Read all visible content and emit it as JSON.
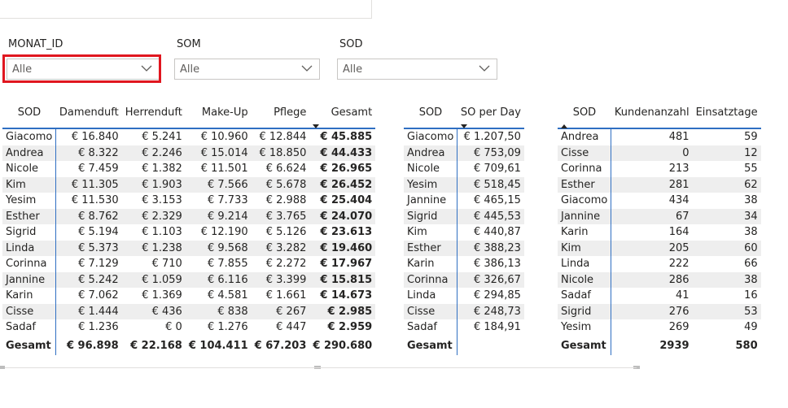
{
  "slicers": [
    {
      "label": "MONAT_ID",
      "value": "Alle"
    },
    {
      "label": "SOM",
      "value": "Alle"
    },
    {
      "label": "SOD",
      "value": "Alle"
    }
  ],
  "table1": {
    "headers": [
      "SOD",
      "Damenduft",
      "Herrenduft",
      "Make-Up",
      "Pflege",
      "Gesamt"
    ],
    "rows": [
      [
        "Giacomo",
        "€ 16.840",
        "€ 5.241",
        "€ 10.960",
        "€ 12.844",
        "€ 45.885"
      ],
      [
        "Andrea",
        "€ 8.322",
        "€ 2.246",
        "€ 15.014",
        "€ 18.850",
        "€ 44.433"
      ],
      [
        "Nicole",
        "€ 7.459",
        "€ 1.382",
        "€ 11.501",
        "€ 6.624",
        "€ 26.965"
      ],
      [
        "Kim",
        "€ 11.305",
        "€ 1.903",
        "€ 7.566",
        "€ 5.678",
        "€ 26.452"
      ],
      [
        "Yesim",
        "€ 11.530",
        "€ 3.153",
        "€ 7.733",
        "€ 2.988",
        "€ 25.404"
      ],
      [
        "Esther",
        "€ 8.762",
        "€ 2.329",
        "€ 9.214",
        "€ 3.765",
        "€ 24.070"
      ],
      [
        "Sigrid",
        "€ 5.194",
        "€ 1.103",
        "€ 12.190",
        "€ 5.126",
        "€ 23.613"
      ],
      [
        "Linda",
        "€ 5.373",
        "€ 1.238",
        "€ 9.568",
        "€ 3.282",
        "€ 19.460"
      ],
      [
        "Corinna",
        "€ 7.129",
        "€ 710",
        "€ 7.855",
        "€ 2.272",
        "€ 17.967"
      ],
      [
        "Jannine",
        "€ 5.242",
        "€ 1.059",
        "€ 6.116",
        "€ 3.399",
        "€ 15.815"
      ],
      [
        "Karin",
        "€ 7.062",
        "€ 1.369",
        "€ 4.581",
        "€ 1.661",
        "€ 14.673"
      ],
      [
        "Cisse",
        "€ 1.444",
        "€ 436",
        "€ 838",
        "€ 267",
        "€ 2.985"
      ],
      [
        "Sadaf",
        "€ 1.236",
        "€ 0",
        "€ 1.276",
        "€ 447",
        "€ 2.959"
      ]
    ],
    "total": [
      "Gesamt",
      "€ 96.898",
      "€ 22.168",
      "€ 104.411",
      "€ 67.203",
      "€ 290.680"
    ]
  },
  "table2": {
    "headers": [
      "SOD",
      "SO per Day"
    ],
    "rows": [
      [
        "Giacomo",
        "€ 1.207,50"
      ],
      [
        "Andrea",
        "€ 753,09"
      ],
      [
        "Nicole",
        "€ 709,61"
      ],
      [
        "Yesim",
        "€ 518,45"
      ],
      [
        "Jannine",
        "€ 465,15"
      ],
      [
        "Sigrid",
        "€ 445,53"
      ],
      [
        "Kim",
        "€ 440,87"
      ],
      [
        "Esther",
        "€ 388,23"
      ],
      [
        "Karin",
        "€ 386,13"
      ],
      [
        "Corinna",
        "€ 326,67"
      ],
      [
        "Linda",
        "€ 294,85"
      ],
      [
        "Cisse",
        "€ 248,73"
      ],
      [
        "Sadaf",
        "€ 184,91"
      ]
    ],
    "total": [
      "Gesamt",
      ""
    ]
  },
  "table3": {
    "headers": [
      "SOD",
      "Kundenanzahl",
      "Einsatztage"
    ],
    "rows": [
      [
        "Andrea",
        "481",
        "59"
      ],
      [
        "Cisse",
        "0",
        "12"
      ],
      [
        "Corinna",
        "213",
        "55"
      ],
      [
        "Esther",
        "281",
        "62"
      ],
      [
        "Giacomo",
        "434",
        "38"
      ],
      [
        "Jannine",
        "67",
        "34"
      ],
      [
        "Karin",
        "164",
        "38"
      ],
      [
        "Kim",
        "205",
        "60"
      ],
      [
        "Linda",
        "222",
        "66"
      ],
      [
        "Nicole",
        "286",
        "38"
      ],
      [
        "Sadaf",
        "41",
        "16"
      ],
      [
        "Sigrid",
        "276",
        "53"
      ],
      [
        "Yesim",
        "269",
        "49"
      ]
    ],
    "total": [
      "Gesamt",
      "2939",
      "580"
    ]
  },
  "colors": {
    "highlight": "#e0161f",
    "header_rule": "#2f6fc2",
    "alt_row": "#eeeeee"
  }
}
